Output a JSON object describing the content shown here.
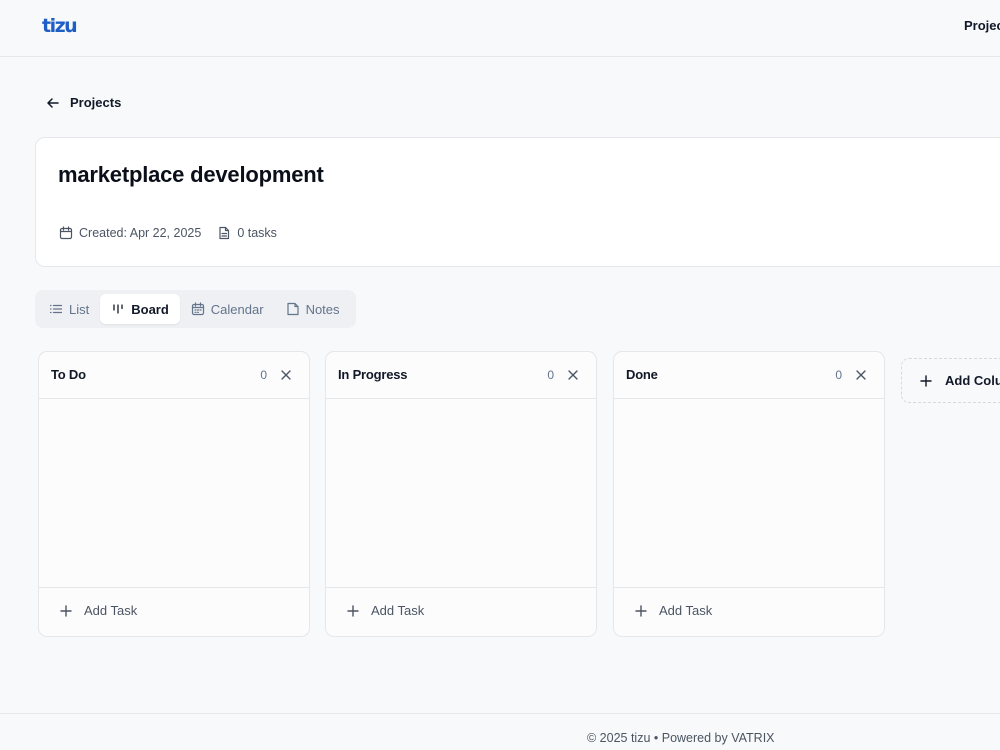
{
  "header": {
    "logo_text": "tizu",
    "nav_projects": "Projects"
  },
  "breadcrumb": {
    "back_label": "Projects"
  },
  "project": {
    "title": "marketplace development",
    "created": "Created: Apr 22, 2025",
    "task_count": "0 tasks"
  },
  "tabs": [
    {
      "label": "List",
      "icon": "list-icon",
      "active": false
    },
    {
      "label": "Board",
      "icon": "board-icon",
      "active": true
    },
    {
      "label": "Calendar",
      "icon": "calendar-icon",
      "active": false
    },
    {
      "label": "Notes",
      "icon": "note-icon",
      "active": false
    }
  ],
  "board": {
    "columns": [
      {
        "title": "To Do",
        "count": "0",
        "add_label": "Add Task"
      },
      {
        "title": "In Progress",
        "count": "0",
        "add_label": "Add Task"
      },
      {
        "title": "Done",
        "count": "0",
        "add_label": "Add Task"
      }
    ],
    "add_column_label": "Add Column"
  },
  "footer": {
    "text": "© 2025 tizu • Powered by VATRIX"
  },
  "colors": {
    "brand": "#1e5fc7",
    "background": "#f8f9fa",
    "border": "#e5e7eb",
    "muted_text": "#64748b"
  }
}
